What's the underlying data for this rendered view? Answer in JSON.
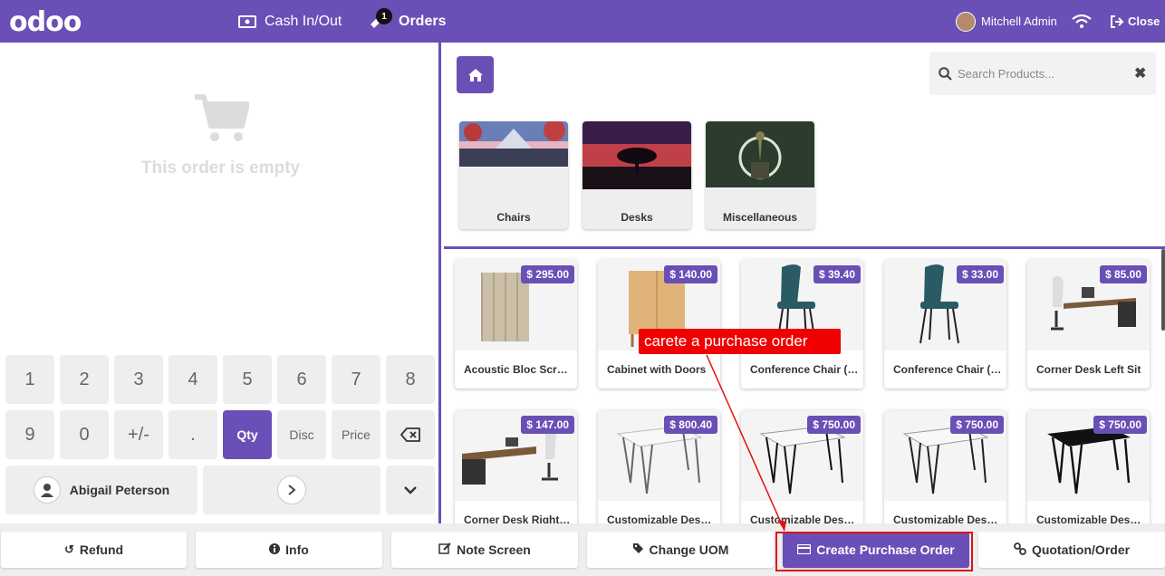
{
  "topbar": {
    "logo": "odoo",
    "cash_label": "Cash In/Out",
    "orders_label": "Orders",
    "orders_count": "1",
    "user_name": "Mitchell Admin",
    "close_label": "Close",
    "accent": "#6a4fb6"
  },
  "order": {
    "empty_text": "This order is empty"
  },
  "numpad": {
    "keys_row1": [
      "1",
      "2",
      "3",
      "4",
      "5",
      "6",
      "7",
      "8"
    ],
    "keys_row2": [
      "9",
      "0",
      "+/-",
      ".",
      "Qty",
      "Disc",
      "Price"
    ],
    "active_mode": "Qty",
    "customer": "Abigail Peterson"
  },
  "search": {
    "placeholder": "Search Products..."
  },
  "categories": [
    {
      "label": "Chairs"
    },
    {
      "label": "Desks"
    },
    {
      "label": "Miscellaneous"
    }
  ],
  "products": [
    {
      "name": "Acoustic Bloc Screens",
      "price": "$ 295.00"
    },
    {
      "name": "Cabinet with Doors",
      "price": "$ 140.00"
    },
    {
      "name": "Conference Chair (Aluminium)",
      "price": "$ 39.40"
    },
    {
      "name": "Conference Chair (Steel)",
      "price": "$ 33.00"
    },
    {
      "name": "Corner Desk Left Sit",
      "price": "$ 85.00"
    },
    {
      "name": "Corner Desk Right Sit",
      "price": "$ 147.00"
    },
    {
      "name": "Customizable Desk (Aluminium, White)",
      "price": "$ 800.40"
    },
    {
      "name": "Customizable Desk (Steel, White)",
      "price": "$ 750.00"
    },
    {
      "name": "Customizable Desk (Custom, White)",
      "price": "$ 750.00"
    },
    {
      "name": "Customizable Desk (Steel, Black)",
      "price": "$ 750.00"
    }
  ],
  "actions": {
    "refund": "Refund",
    "info": "Info",
    "note_screen": "Note Screen",
    "change_uom": "Change UOM",
    "create_po": "Create Purchase Order",
    "quotation": "Quotation/Order"
  },
  "annotation": {
    "text": "carete a purchase order",
    "color": "#f00000"
  }
}
